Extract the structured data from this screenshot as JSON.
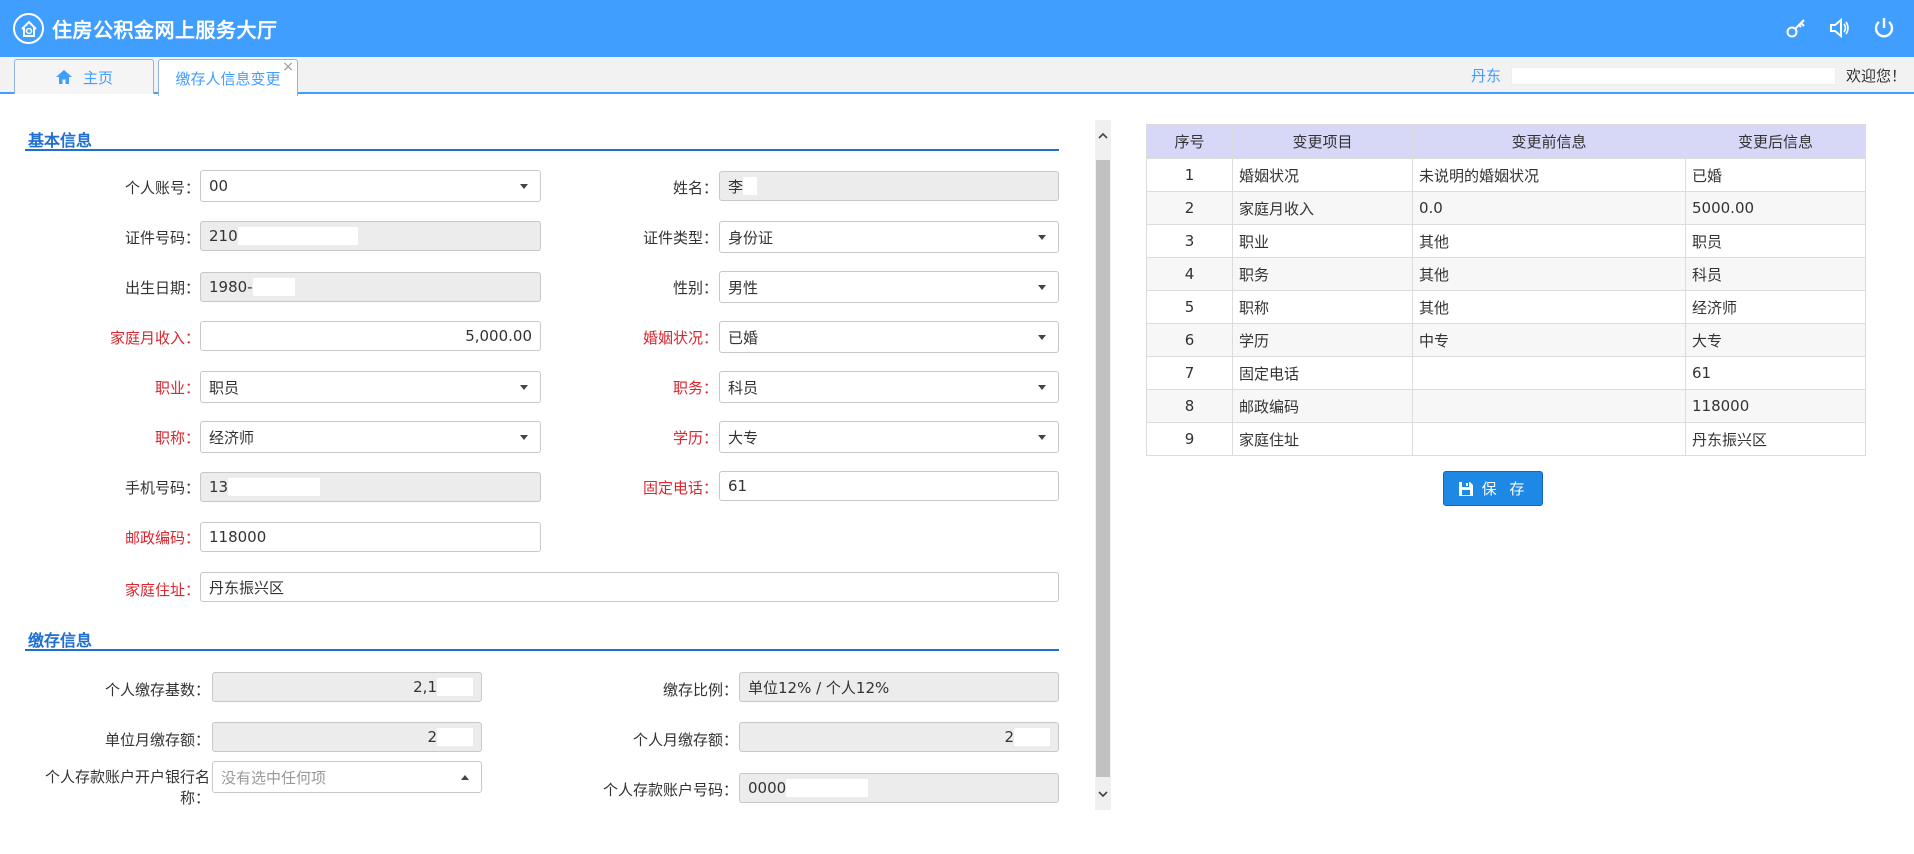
{
  "header": {
    "title": "住房公积金网上服务大厅",
    "icons": [
      "key-icon",
      "speaker-icon",
      "power-icon"
    ]
  },
  "tabs": {
    "home": "主页",
    "active": "缴存人信息变更",
    "close": "×"
  },
  "user": {
    "city": "丹东",
    "welcome": "欢迎您！"
  },
  "basic": {
    "section_title": "基本信息",
    "account": {
      "label": "个人账号：",
      "value": "00"
    },
    "name": {
      "label": "姓名：",
      "value": "李"
    },
    "id_number": {
      "label": "证件号码：",
      "value": "210"
    },
    "id_type": {
      "label": "证件类型：",
      "value": "身份证"
    },
    "birth": {
      "label": "出生日期：",
      "value": "1980-"
    },
    "gender": {
      "label": "性别：",
      "value": "男性"
    },
    "income": {
      "label": "家庭月收入：",
      "value": "5,000.00"
    },
    "marital": {
      "label": "婚姻状况：",
      "value": "已婚"
    },
    "occupation": {
      "label": "职业：",
      "value": "职员"
    },
    "position": {
      "label": "职务：",
      "value": "科员"
    },
    "title": {
      "label": "职称：",
      "value": "经济师"
    },
    "education": {
      "label": "学历：",
      "value": "大专"
    },
    "mobile": {
      "label": "手机号码：",
      "value": "13"
    },
    "phone": {
      "label": "固定电话：",
      "value": "61"
    },
    "postcode": {
      "label": "邮政编码：",
      "value": "118000"
    },
    "address": {
      "label": "家庭住址：",
      "value": "丹东振兴区"
    }
  },
  "deposit": {
    "section_title": "缴存信息",
    "base": {
      "label": "个人缴存基数：",
      "value": "2,1"
    },
    "ratio": {
      "label": "缴存比例：",
      "value": "单位12% / 个人12%"
    },
    "unit_monthly": {
      "label": "单位月缴存额：",
      "value": "2"
    },
    "personal_monthly": {
      "label": "个人月缴存额：",
      "value": "2"
    },
    "bank": {
      "label": "个人存款账户开户银行名称：",
      "placeholder": "没有选中任何项"
    },
    "bank_account": {
      "label": "个人存款账户号码：",
      "value": "0000"
    }
  },
  "changes": {
    "headers": [
      "序号",
      "变更项目",
      "变更前信息",
      "变更后信息"
    ],
    "rows": [
      [
        "1",
        "婚姻状况",
        "未说明的婚姻状况",
        "已婚"
      ],
      [
        "2",
        "家庭月收入",
        "0.0",
        "5000.00"
      ],
      [
        "3",
        "职业",
        "其他",
        "职员"
      ],
      [
        "4",
        "职务",
        "其他",
        "科员"
      ],
      [
        "5",
        "职称",
        "其他",
        "经济师"
      ],
      [
        "6",
        "学历",
        "中专",
        "大专"
      ],
      [
        "7",
        "固定电话",
        "",
        "61"
      ],
      [
        "8",
        "邮政编码",
        "",
        "118000"
      ],
      [
        "9",
        "家庭住址",
        "",
        "丹东振兴区"
      ]
    ],
    "save_label": "保 存"
  }
}
